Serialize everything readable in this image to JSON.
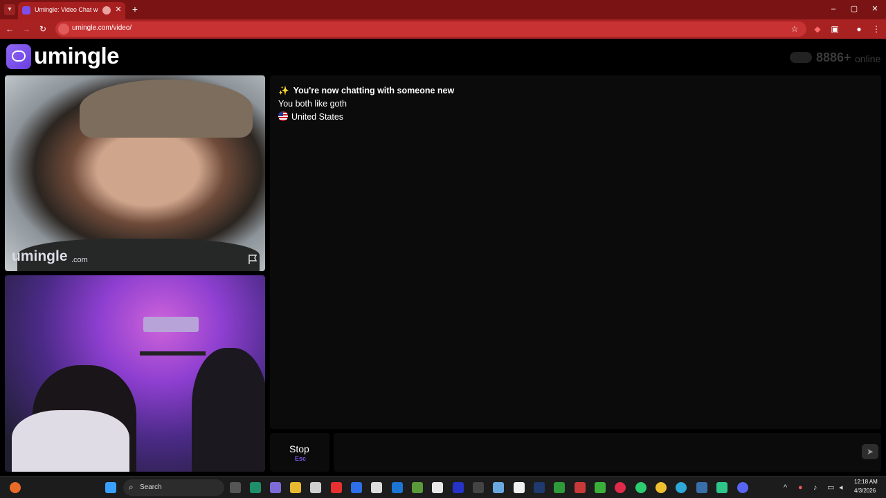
{
  "browser": {
    "tab_title": "Umingle: Video Chat with S",
    "new_tab_icon": "+",
    "url": "umingle.com/video/",
    "window_controls": [
      "–",
      "▢",
      "✕"
    ]
  },
  "site": {
    "logo_text": "umingle",
    "online_count": "8886+",
    "online_label": "online"
  },
  "video": {
    "watermark_main": "umingle",
    "watermark_sub": ".com"
  },
  "chat": {
    "sparkle": "✨",
    "status_line": "You're now chatting with someone new",
    "interest_line": "You both like goth",
    "country": "United States",
    "stop_label": "Stop",
    "stop_hint": "Esc"
  },
  "taskbar": {
    "search_label": "Search",
    "time": "12:18 AM",
    "date": "4/3/2026"
  },
  "colors": {
    "brand": "#7b4fe8",
    "browser_frame": "#a82222",
    "page_background": "#000000",
    "panel": "#0b0b0b"
  }
}
